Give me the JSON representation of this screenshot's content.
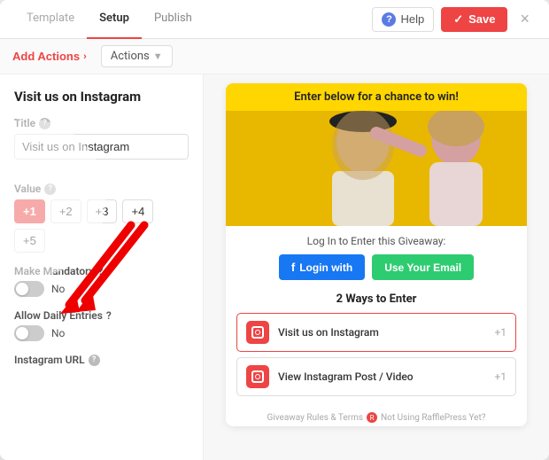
{
  "header": {
    "tab_template": "Template",
    "tab_setup": "Setup",
    "tab_publish": "Publish",
    "help_label": "Help",
    "save_label": "Save",
    "close_label": "×"
  },
  "subheader": {
    "add_actions_label": "Add Actions",
    "actions_dropdown_label": "Actions",
    "chevron": "›"
  },
  "left_panel": {
    "panel_title": "Visit us on Instagram",
    "title_label": "Title",
    "title_value": "Visit us on Instagram",
    "value_label": "Value",
    "value_options": [
      "+1",
      "+2",
      "+3",
      "+4",
      "+5"
    ],
    "value_active": "+1",
    "make_mandatory_label": "Make Mandatory",
    "make_mandatory_toggle": "No",
    "allow_daily_label": "Allow Daily Entries",
    "allow_daily_toggle": "No",
    "instagram_url_label": "Instagram URL"
  },
  "right_panel": {
    "banner_text": "Enter below for a chance to win!",
    "login_label": "Log In to Enter this Giveaway:",
    "login_fb_label": "Login with",
    "login_fb_icon": "f",
    "login_email_label": "Use Your Email",
    "ways_title": "2 Ways to Enter",
    "entries": [
      {
        "label": "Visit us on Instagram",
        "points": "+1"
      },
      {
        "label": "View Instagram Post / Video",
        "points": "+1"
      }
    ],
    "footer": "Giveaway Rules & Terms",
    "footer_suffix": "Not Using RafflePress Yet?"
  }
}
